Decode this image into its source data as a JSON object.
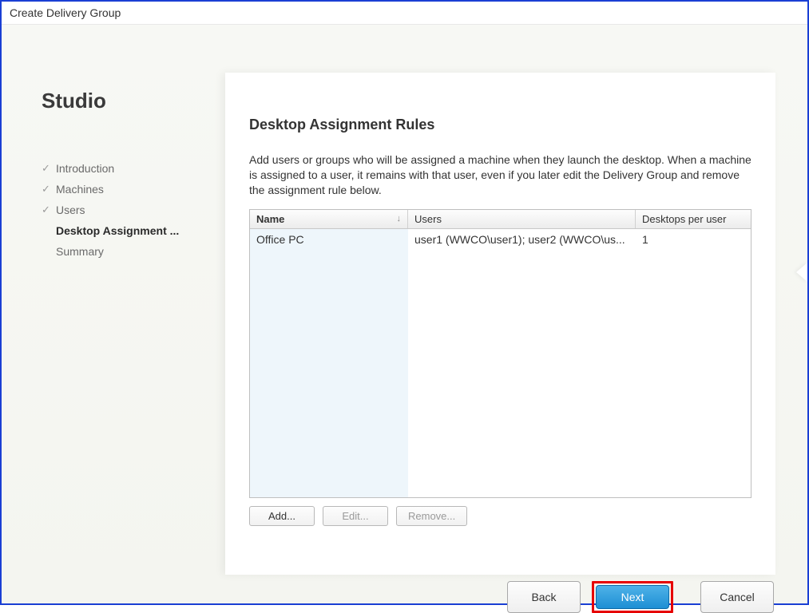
{
  "window": {
    "title": "Create Delivery Group"
  },
  "sidebar": {
    "brand": "Studio",
    "items": [
      {
        "label": "Introduction",
        "done": true,
        "current": false
      },
      {
        "label": "Machines",
        "done": true,
        "current": false
      },
      {
        "label": "Users",
        "done": true,
        "current": false
      },
      {
        "label": "Desktop Assignment ...",
        "done": false,
        "current": true
      },
      {
        "label": "Summary",
        "done": false,
        "current": false
      }
    ]
  },
  "main": {
    "heading": "Desktop Assignment Rules",
    "description": "Add users or groups who will be assigned a machine when they launch the desktop. When a machine is assigned to a user, it remains with that user, even if you later edit the Delivery Group and remove the assignment rule below.",
    "columns": {
      "name": "Name",
      "users": "Users",
      "dpu": "Desktops per user"
    },
    "rows": [
      {
        "name": "Office PC",
        "users": "user1 (WWCO\\user1); user2 (WWCO\\us...",
        "dpu": "1"
      }
    ],
    "actions": {
      "add": "Add...",
      "edit": "Edit...",
      "remove": "Remove..."
    }
  },
  "wizard": {
    "back": "Back",
    "next": "Next",
    "cancel": "Cancel"
  }
}
